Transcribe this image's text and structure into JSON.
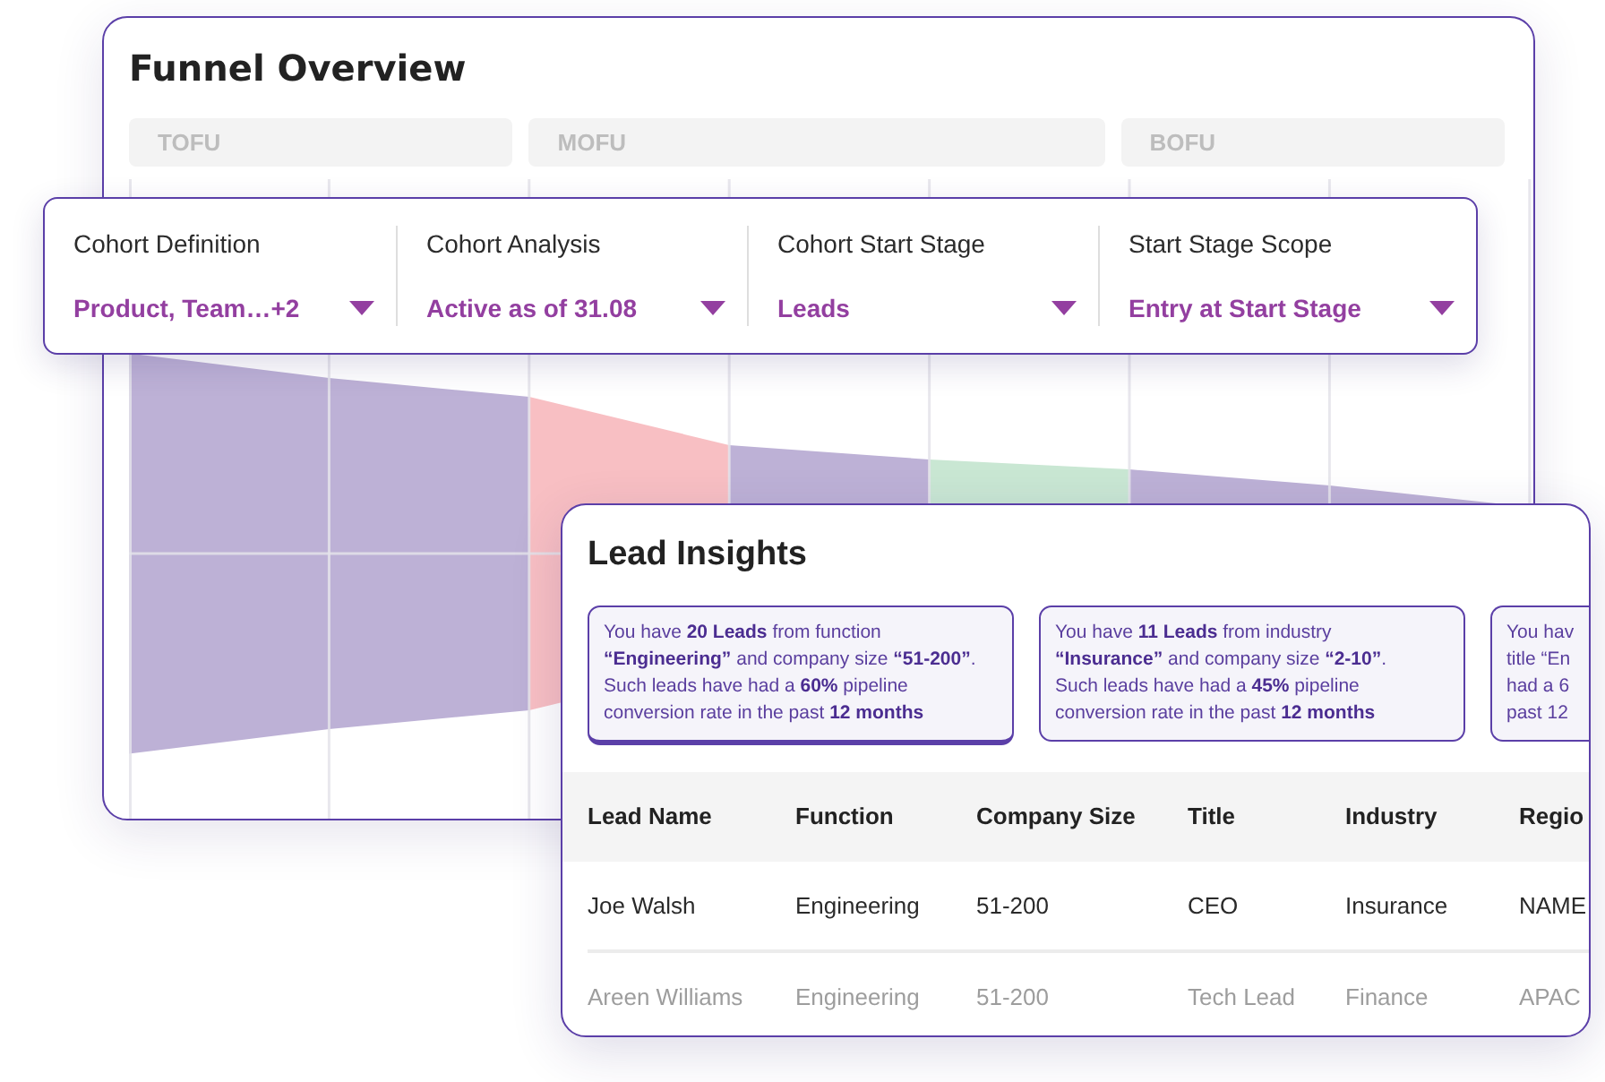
{
  "funnel_overview": {
    "title": "Funnel Overview",
    "stages": [
      "TOFU",
      "MOFU",
      "BOFU"
    ],
    "funnel": {
      "segments": [
        {
          "color": "#bdb1d6"
        },
        {
          "color": "#bdb1d6"
        },
        {
          "color": "#f8bfc3"
        },
        {
          "color": "#bdb1d6"
        },
        {
          "color": "#c9e7d3"
        },
        {
          "color": "#bdb1d6"
        },
        {
          "color": "#bdb1d6"
        }
      ]
    }
  },
  "filters": [
    {
      "label": "Cohort Definition",
      "value": "Product, Team…+2"
    },
    {
      "label": "Cohort Analysis",
      "value": "Active as of 31.08"
    },
    {
      "label": "Cohort Start Stage",
      "value": "Leads"
    },
    {
      "label": "Start Stage Scope",
      "value": "Entry at Start Stage"
    }
  ],
  "lead_insights": {
    "title": "Lead Insights",
    "insights": [
      {
        "text": "You have **20 Leads** from function\n**“Engineering”** and company size **“51-200”**.\nSuch leads have had a **60%** pipeline\nconversion rate in the past **12 months**",
        "selected": true
      },
      {
        "text": "You have **11 Leads** from industry\n**“Insurance”** and company size **“2-10”**.\nSuch leads have had a **45%** pipeline\nconversion rate in the past **12 months**",
        "selected": false
      },
      {
        "text": "You hav\ntitle “En\nhad a 6\npast 12",
        "selected": false
      }
    ],
    "table": {
      "columns": [
        "Lead Name",
        "Function",
        "Company Size",
        "Title",
        "Industry",
        "Regio"
      ],
      "rows": [
        {
          "cells": [
            "Joe Walsh",
            "Engineering",
            "51-200",
            "CEO",
            "Insurance",
            "NAME"
          ],
          "muted": false
        },
        {
          "cells": [
            "Areen Williams",
            "Engineering",
            "51-200",
            "Tech Lead",
            "Finance",
            "APAC"
          ],
          "muted": true
        }
      ]
    }
  }
}
